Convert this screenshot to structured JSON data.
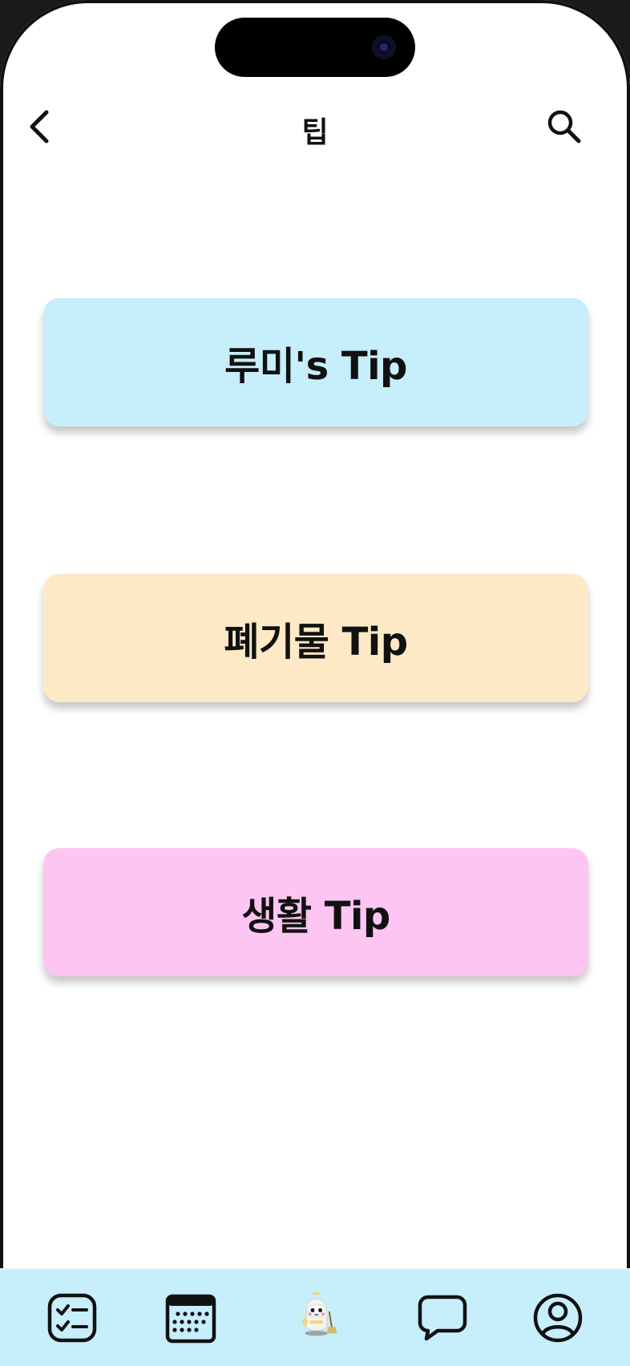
{
  "header": {
    "title": "팁",
    "back_icon": "chevron-left-icon",
    "search_icon": "search-icon"
  },
  "cards": [
    {
      "label": "루미's Tip",
      "color": "#c6eefb"
    },
    {
      "label": "폐기물 Tip",
      "color": "#fde9c6"
    },
    {
      "label": "생활 Tip",
      "color": "#fcc5f2"
    }
  ],
  "tabbar": {
    "background": "#c6eefb",
    "items": [
      {
        "icon": "checklist-icon"
      },
      {
        "icon": "calendar-icon"
      },
      {
        "icon": "robot-mascot-icon"
      },
      {
        "icon": "chat-bubble-icon"
      },
      {
        "icon": "profile-icon"
      }
    ]
  }
}
